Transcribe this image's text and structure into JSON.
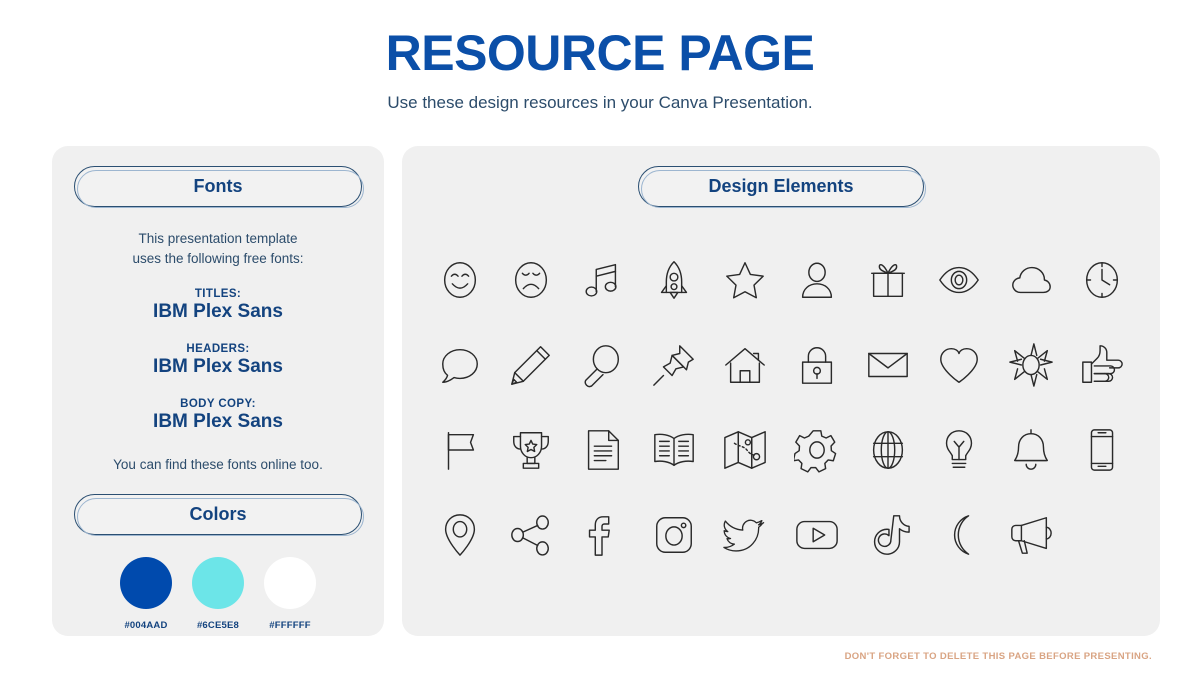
{
  "header": {
    "title": "RESOURCE PAGE",
    "subtitle": "Use these design resources in your Canva Presentation."
  },
  "fonts_panel": {
    "pill_label": "Fonts",
    "intro_line1": "This presentation template",
    "intro_line2": "uses the following free fonts:",
    "entries": [
      {
        "role": "TITLES:",
        "name": "IBM Plex Sans"
      },
      {
        "role": "HEADERS:",
        "name": "IBM Plex Sans"
      },
      {
        "role": "BODY COPY:",
        "name": "IBM Plex Sans"
      }
    ],
    "footnote": "You can find these fonts online too."
  },
  "colors_panel": {
    "pill_label": "Colors",
    "swatches": [
      {
        "hex": "#004AAD",
        "label": "#004AAD"
      },
      {
        "hex": "#6CE5E8",
        "label": "#6CE5E8"
      },
      {
        "hex": "#FFFFFF",
        "label": "#FFFFFF"
      }
    ]
  },
  "elements_panel": {
    "pill_label": "Design Elements",
    "icons": [
      "smiley-face-icon",
      "sad-face-icon",
      "music-notes-icon",
      "rocket-icon",
      "star-icon",
      "person-icon",
      "gift-icon",
      "eye-icon",
      "cloud-icon",
      "clock-icon",
      "speech-bubble-icon",
      "pencil-icon",
      "magnifying-glass-icon",
      "pushpin-icon",
      "house-icon",
      "lock-icon",
      "envelope-icon",
      "heart-icon",
      "sun-icon",
      "thumbs-up-icon",
      "flag-icon",
      "trophy-icon",
      "document-icon",
      "book-icon",
      "map-icon",
      "gear-icon",
      "globe-icon",
      "lightbulb-icon",
      "bell-icon",
      "phone-icon",
      "location-pin-icon",
      "share-icon",
      "facebook-icon",
      "instagram-icon",
      "twitter-icon",
      "youtube-icon",
      "tiktok-icon",
      "moon-icon",
      "megaphone-icon"
    ]
  },
  "footer": {
    "note": "DON'T FORGET TO DELETE THIS PAGE BEFORE PRESENTING."
  },
  "theme": {
    "brand_blue": "#004AAD",
    "title_blue": "#0B4FA8",
    "text_slate": "#2C4C6B",
    "panel_bg": "#F0F0F0",
    "footer_salmon": "#D9A483",
    "icon_stroke": "#2A2A2A"
  }
}
